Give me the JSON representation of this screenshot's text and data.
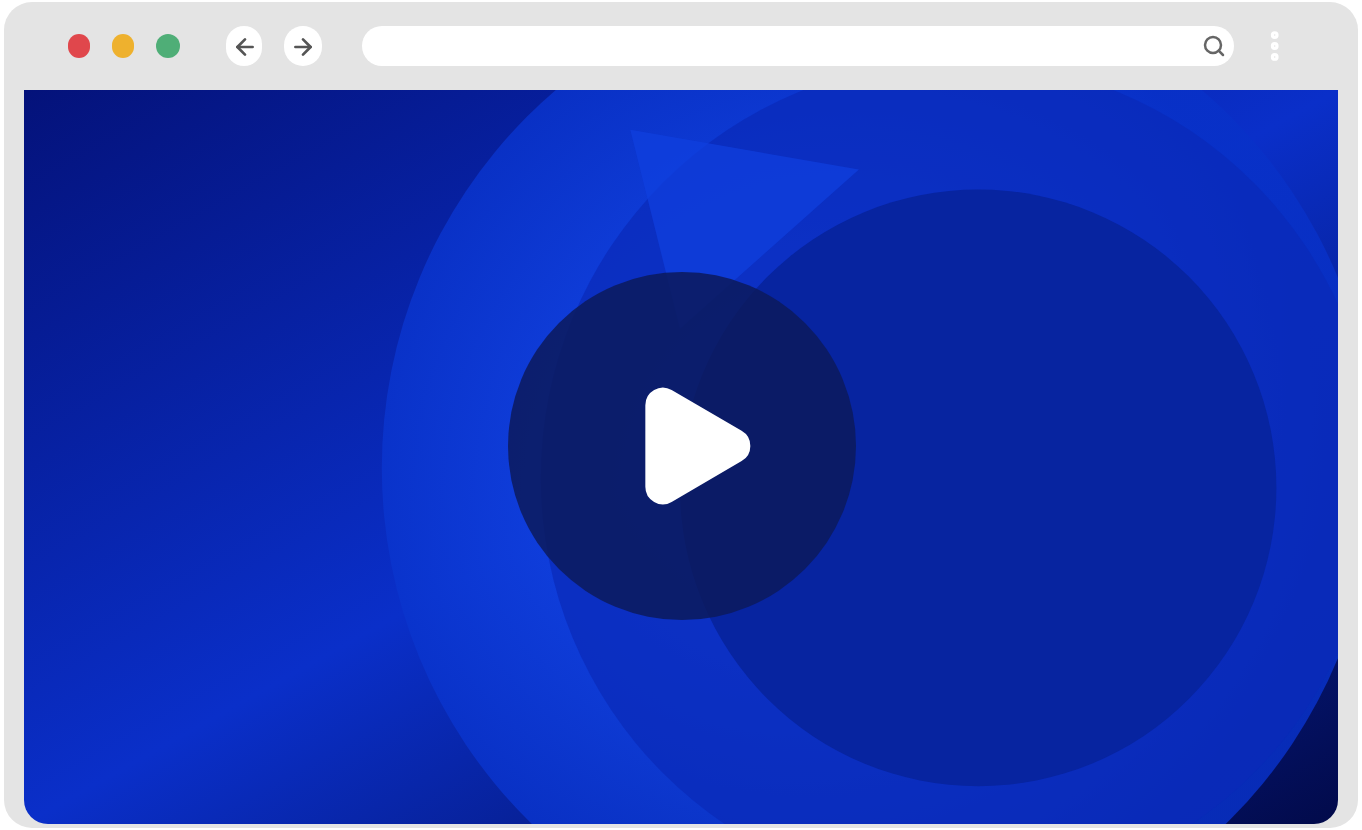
{
  "window_controls": [
    {
      "color": "#e0474c"
    },
    {
      "color": "#eeb12e"
    },
    {
      "color": "#4fae77"
    }
  ],
  "video": {
    "playing": false
  }
}
